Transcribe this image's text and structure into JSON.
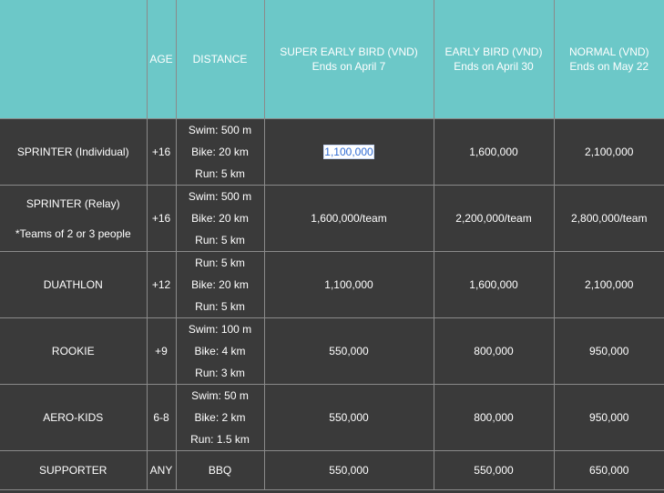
{
  "header": {
    "empty": "",
    "age": "AGE",
    "distance": "DISTANCE",
    "super_early": {
      "title": "SUPER EARLY BIRD (VND)",
      "sub": "Ends on April 7"
    },
    "early": {
      "title": "EARLY BIRD (VND)",
      "sub": "Ends on April 30"
    },
    "normal": {
      "title": "NORMAL (VND)",
      "sub": "Ends on May 22"
    }
  },
  "rows": [
    {
      "name": "SPRINTER (Individual)",
      "note": "",
      "age": "+16",
      "distance": [
        "Swim: 500 m",
        "Bike: 20 km",
        "Run: 5 km"
      ],
      "super_early": "1,100,000",
      "early": "1,600,000",
      "normal": "2,100,000"
    },
    {
      "name": "SPRINTER (Relay)",
      "note": "*Teams of 2 or 3 people",
      "age": "+16",
      "distance": [
        "Swim: 500 m",
        "Bike: 20 km",
        "Run: 5 km"
      ],
      "super_early": "1,600,000/team",
      "early": "2,200,000/team",
      "normal": "2,800,000/team"
    },
    {
      "name": "DUATHLON",
      "note": "",
      "age": "+12",
      "distance": [
        "Run: 5 km",
        "Bike: 20 km",
        "Run: 5 km"
      ],
      "super_early": "1,100,000",
      "early": "1,600,000",
      "normal": "2,100,000"
    },
    {
      "name": "ROOKIE",
      "note": "",
      "age": "+9",
      "distance": [
        "Swim: 100 m",
        "Bike: 4 km",
        "Run: 3 km"
      ],
      "super_early": "550,000",
      "early": "800,000",
      "normal": "950,000"
    },
    {
      "name": "AERO-KIDS",
      "note": "",
      "age": "6-8",
      "distance": [
        "Swim: 50 m",
        "Bike: 2 km",
        "Run: 1.5 km"
      ],
      "super_early": "550,000",
      "early": "800,000",
      "normal": "950,000"
    },
    {
      "name": "SUPPORTER",
      "note": "",
      "age": "ANY",
      "distance": [
        "BBQ"
      ],
      "super_early": "550,000",
      "early": "550,000",
      "normal": "650,000"
    }
  ],
  "colors": {
    "header_bg": "#6cc8c8",
    "body_bg": "#3a3a3a",
    "border": "#8a8a8a",
    "selection_text": "#2f6bd4"
  }
}
